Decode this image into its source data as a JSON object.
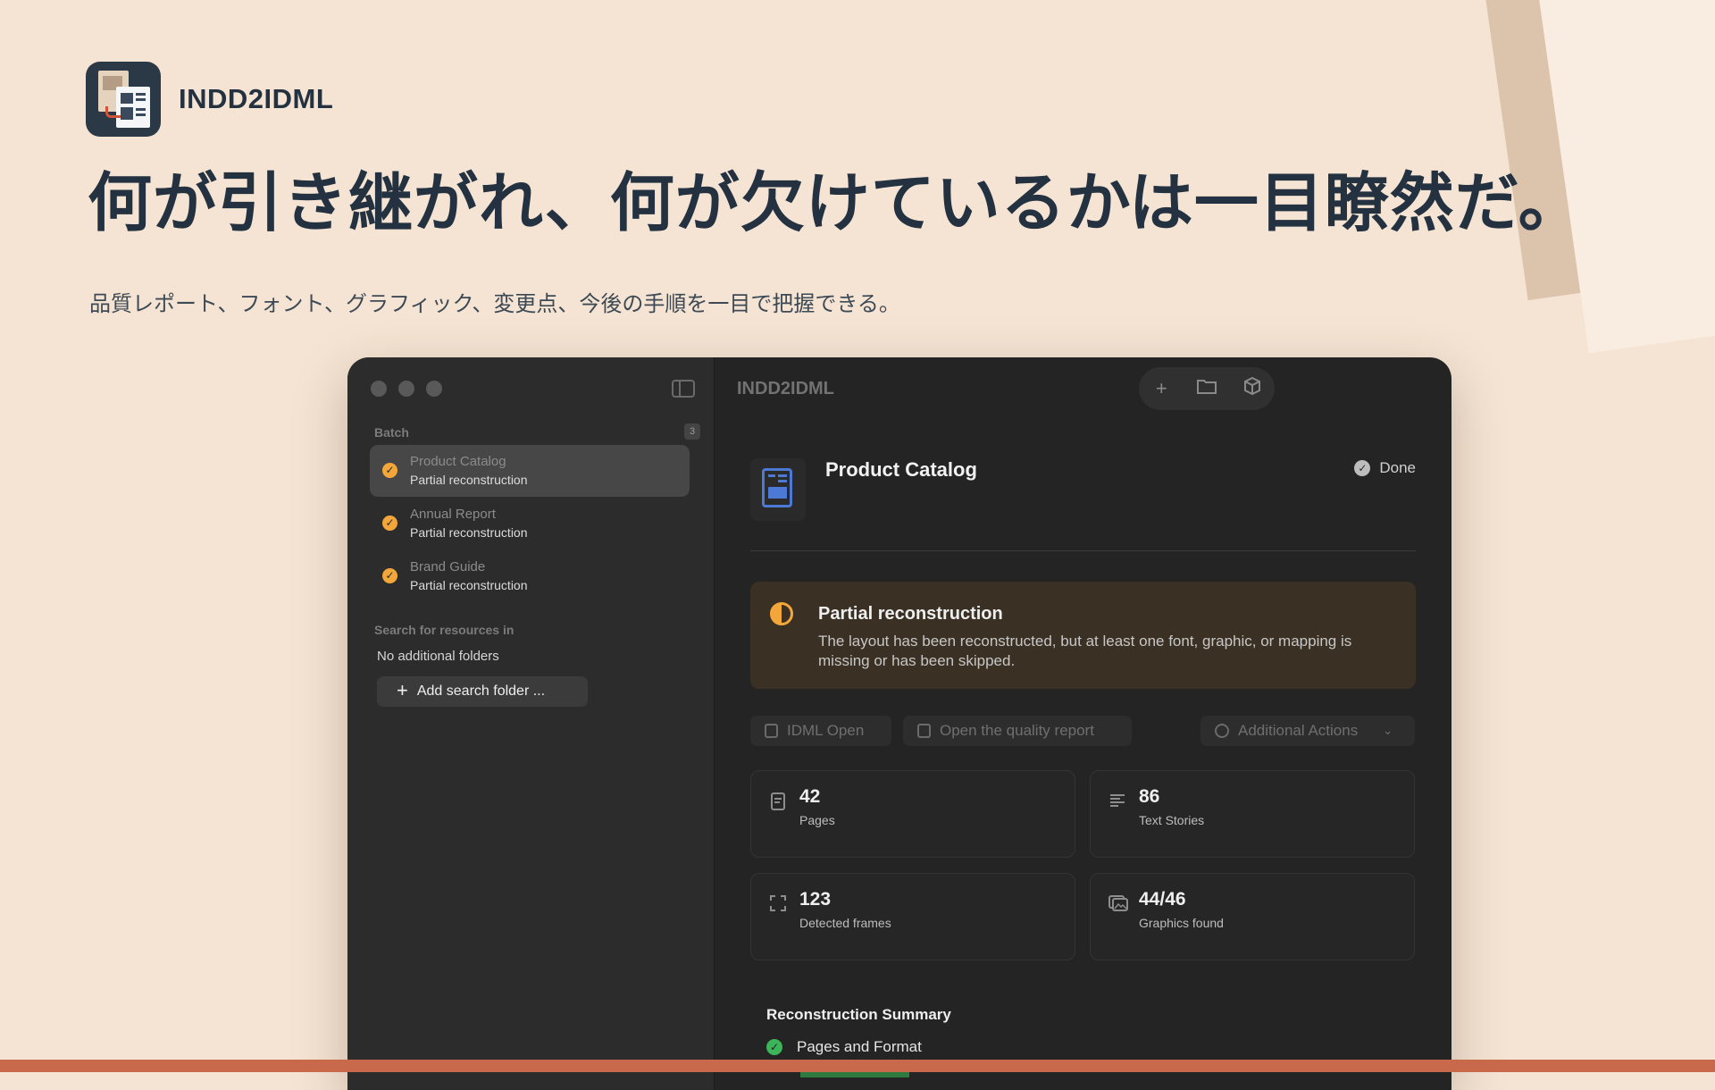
{
  "hero": {
    "brand": "INDD2IDML",
    "headline": "何が引き継がれ、何が欠けているかは一目瞭然だ。",
    "subheadline": "品質レポート、フォント、グラフィック、変更点、今後の手順を一目で把握できる。"
  },
  "colors": {
    "background": "#f5e4d3",
    "headline": "#233140",
    "window": "#242424",
    "sidebar": "#2c2c2c",
    "warning_accent": "#f3a73b",
    "success": "#3bb45a",
    "bottom_band": "#c9694c"
  },
  "window": {
    "title": "INDD2IDML",
    "toolbar_icons": [
      "plus-icon",
      "folder-icon",
      "package-icon",
      "convert-icon",
      "help-icon",
      "info-icon"
    ]
  },
  "sidebar": {
    "batch_label": "Batch",
    "batch_count": "3",
    "items": [
      {
        "title": "Product Catalog",
        "status": "Partial reconstruction",
        "selected": true
      },
      {
        "title": "Annual Report",
        "status": "Partial reconstruction",
        "selected": false
      },
      {
        "title": "Brand Guide",
        "status": "Partial reconstruction",
        "selected": false
      }
    ],
    "search_label": "Search for resources in",
    "no_folders": "No additional folders",
    "add_folder_button": "Add search folder ..."
  },
  "detail": {
    "title": "Product Catalog",
    "status": "Done",
    "alert": {
      "title": "Partial reconstruction",
      "body": "The layout has been reconstructed, but at least one font, graphic, or mapping is missing or has been skipped."
    },
    "actions": {
      "idml_open": "IDML Open",
      "quality_report": "Open the quality report",
      "additional": "Additional Actions"
    },
    "stats": [
      {
        "value": "42",
        "label": "Pages",
        "icon": "page-icon"
      },
      {
        "value": "86",
        "label": "Text Stories",
        "icon": "text-lines-icon"
      },
      {
        "value": "123",
        "label": "Detected frames",
        "icon": "frame-icon"
      },
      {
        "value": "44/46",
        "label": "Graphics found",
        "icon": "images-icon"
      }
    ],
    "summary": {
      "title": "Reconstruction Summary",
      "rows": [
        {
          "label": "Pages and Format"
        }
      ]
    }
  }
}
